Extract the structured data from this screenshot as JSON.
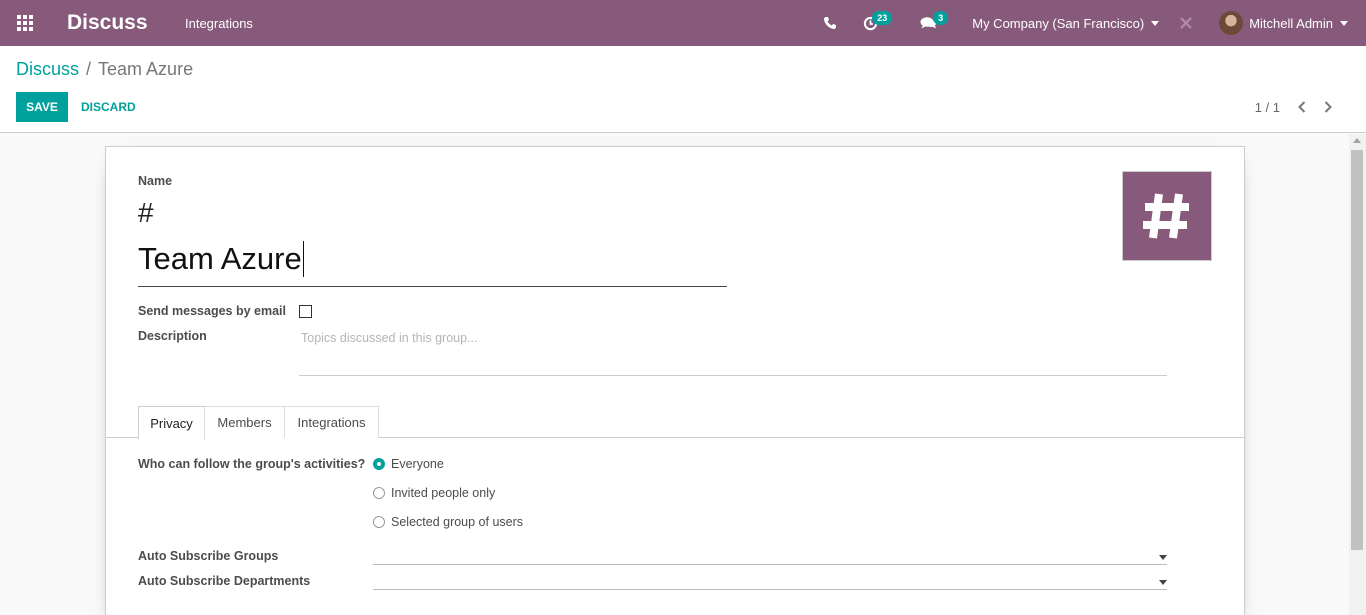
{
  "navbar": {
    "app_title": "Discuss",
    "menu_item": "Integrations",
    "activity_count": "23",
    "messages_count": "3",
    "company": "My Company (San Francisco)",
    "user": "Mitchell Admin"
  },
  "breadcrumb": {
    "parent": "Discuss",
    "separator": "/",
    "current": "Team Azure"
  },
  "toolbar": {
    "save_label": "SAVE",
    "discard_label": "DISCARD"
  },
  "pager": {
    "value": "1 / 1"
  },
  "form": {
    "name_label": "Name",
    "name_prefix": "#",
    "name_value": "Team Azure",
    "send_email_label": "Send messages by email",
    "send_email_checked": false,
    "description_label": "Description",
    "description_placeholder": "Topics discussed in this group...",
    "tabs": [
      "Privacy",
      "Members",
      "Integrations"
    ],
    "active_tab": "Privacy",
    "privacy": {
      "follow_label": "Who can follow the group's activities?",
      "options": [
        "Everyone",
        "Invited people only",
        "Selected group of users"
      ],
      "selected": "Everyone"
    },
    "auto_subscribe_groups_label": "Auto Subscribe Groups",
    "auto_subscribe_departments_label": "Auto Subscribe Departments"
  },
  "colors": {
    "brand": "#875a7b",
    "accent": "#00a09d"
  }
}
